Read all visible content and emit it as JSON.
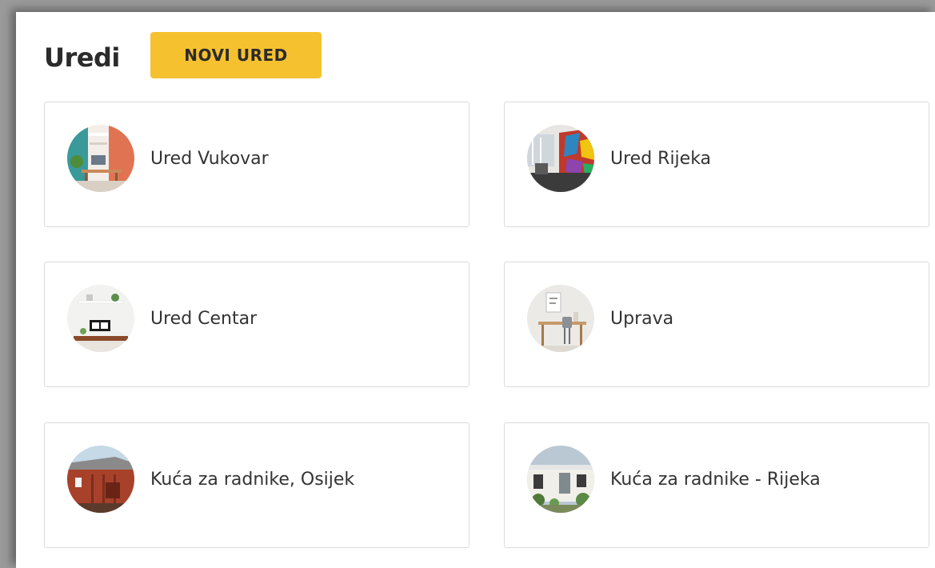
{
  "header": {
    "title": "Uredi",
    "new_button_label": "NOVI URED"
  },
  "offices": [
    {
      "label": "Ured Vukovar",
      "image": "office-desk-coral-photo"
    },
    {
      "label": "Ured Rijeka",
      "image": "office-colorful-mural-photo"
    },
    {
      "label": "Ured Centar",
      "image": "office-shelf-clock-photo"
    },
    {
      "label": "Uprava",
      "image": "office-minimal-desk-photo"
    },
    {
      "label": "Kuća za radnike, Osijek",
      "image": "red-wooden-house-photo"
    },
    {
      "label": "Kuća za radnike - Rijeka",
      "image": "white-house-garden-photo"
    }
  ],
  "colors": {
    "accent": "#f6c12f",
    "card_border": "#dcdcdc",
    "text": "#333333"
  }
}
